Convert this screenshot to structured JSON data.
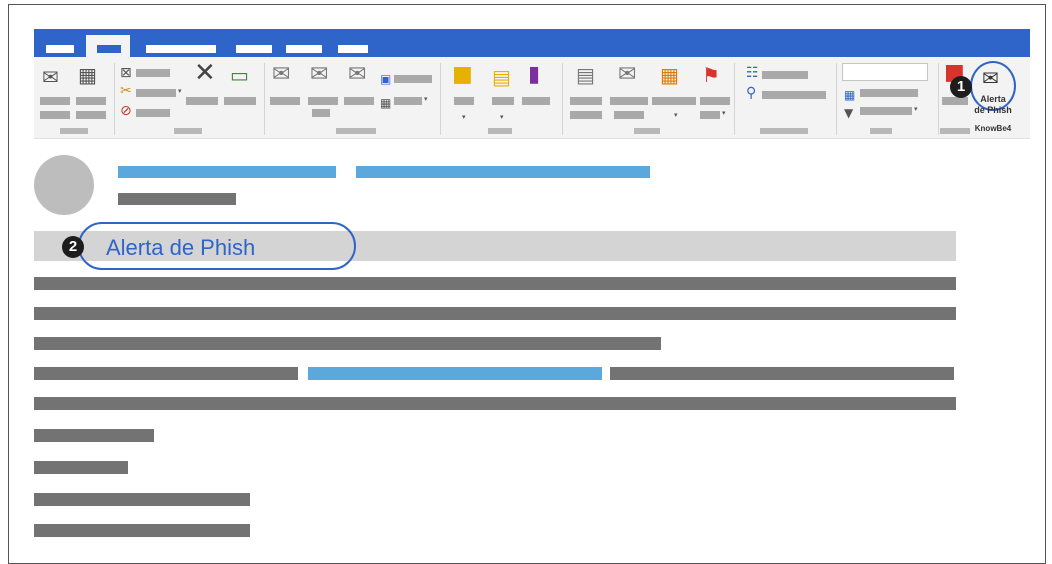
{
  "ribbon": {
    "addin": {
      "label_line1": "Alerta",
      "label_line2": "de Phish",
      "group_label": "KnowBe4",
      "icon": "phish-alert-icon",
      "accent_color": "#2f64c8"
    },
    "icons": [
      "new-email-icon",
      "new-items-icon",
      "ignore-icon",
      "delete-icon",
      "archive-icon",
      "reply-icon",
      "reply-all-icon",
      "forward-icon",
      "meeting-icon",
      "move-icon",
      "rules-icon",
      "onenote-icon",
      "assign-policy-icon",
      "mark-unread-icon",
      "categorize-icon",
      "follow-up-icon",
      "address-book-icon",
      "search-people-icon",
      "filter-email-icon",
      "store-icon"
    ]
  },
  "callouts": {
    "step1": "1",
    "step2": "2"
  },
  "message": {
    "subject": "Alerta de Phish",
    "colors": {
      "link": "#5aa8dc",
      "redacted": "#737373",
      "subject_bar": "#d4d4d4"
    }
  }
}
